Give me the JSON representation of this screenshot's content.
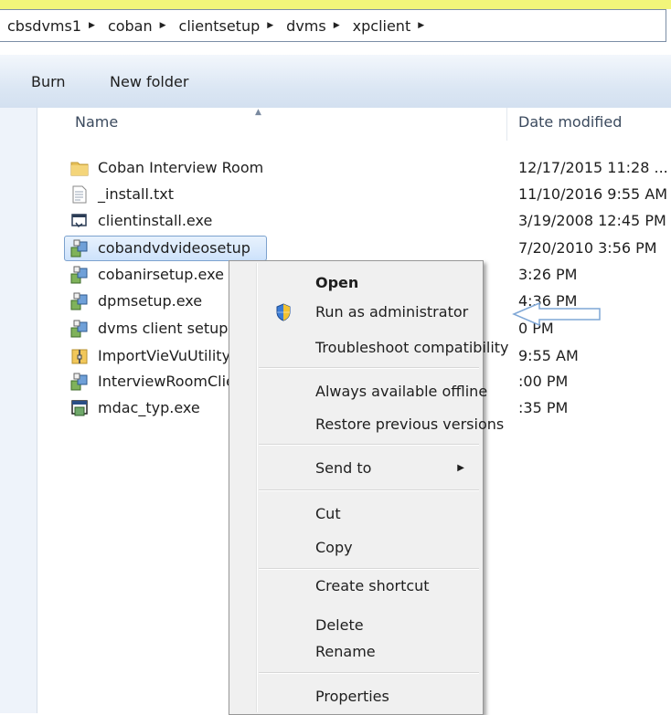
{
  "address": {
    "crumbs": [
      "cbsdvms1",
      "coban",
      "clientsetup",
      "dvms",
      "xpclient"
    ]
  },
  "toolbar": {
    "burn_label": "Burn",
    "new_folder_label": "New folder"
  },
  "columns": {
    "name": "Name",
    "date": "Date modified"
  },
  "files": [
    {
      "name": "Coban Interview Room",
      "date": "12/17/2015 11:28 ...",
      "icon": "folder-icon"
    },
    {
      "name": "_install.txt",
      "date": "11/10/2016 9:55 AM",
      "icon": "text-file-icon"
    },
    {
      "name": "clientinstall.exe",
      "date": "3/19/2008 12:45 PM",
      "icon": "exe-icon"
    },
    {
      "name": "cobandvdvideosetup",
      "date": "7/20/2010 3:56 PM",
      "icon": "installer-icon",
      "selected": true
    },
    {
      "name": "cobanirsetup.exe",
      "date": "3:26 PM",
      "icon": "installer-icon"
    },
    {
      "name": "dpmsetup.exe",
      "date": "4:36 PM",
      "icon": "installer-icon"
    },
    {
      "name": "dvms client setup.ex",
      "date": "0 PM",
      "icon": "installer-icon"
    },
    {
      "name": "ImportVieVuUtility.zi",
      "date": "9:55 AM",
      "icon": "zip-icon"
    },
    {
      "name": "InterviewRoomClien",
      "date": ":00 PM",
      "icon": "installer-icon"
    },
    {
      "name": "mdac_typ.exe",
      "date": ":35 PM",
      "icon": "setup-icon"
    }
  ],
  "context_menu": {
    "items": [
      {
        "label": "Open",
        "bold": true
      },
      {
        "label": "Run as administrator",
        "icon": "uac-shield-icon"
      },
      {
        "label": "Troubleshoot compatibility"
      },
      {
        "label": "Always available offline"
      },
      {
        "label": "Restore previous versions"
      },
      {
        "label": "Send to",
        "submenu": true
      },
      {
        "label": "Cut"
      },
      {
        "label": "Copy"
      },
      {
        "label": "Create shortcut"
      },
      {
        "label": "Delete"
      },
      {
        "label": "Rename"
      },
      {
        "label": "Properties"
      }
    ]
  },
  "colors": {
    "highlight_strip": "#f2f57a",
    "toolbar": "#dce7f4",
    "selection": "#cde2fb",
    "arrow": "#7fa7d6"
  }
}
